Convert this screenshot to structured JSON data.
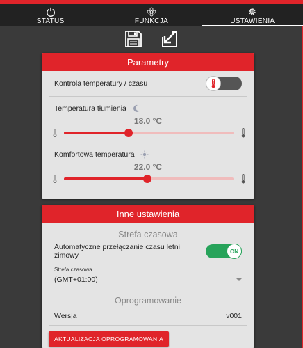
{
  "tabs": [
    {
      "label": "STATUS",
      "icon": "power-icon"
    },
    {
      "label": "FUNKCJA",
      "icon": "flower-icon"
    },
    {
      "label": "USTAWIENIA",
      "icon": "gear-icon",
      "active": true
    }
  ],
  "toolbar": {
    "save_icon": "floppy-disk-icon",
    "load_icon": "import-arrow-icon"
  },
  "parametry": {
    "title": "Parametry",
    "control_label": "Kontrola temperatury / czasu",
    "control_toggle": "off",
    "night": {
      "label": "Temperatura tłumienia",
      "icon": "moon-icon",
      "value": "18.0 °C",
      "level": 0.38
    },
    "comfort": {
      "label": "Komfortowa temperatura",
      "icon": "sun-icon",
      "value": "22.0 °C",
      "level": 0.49
    }
  },
  "inne": {
    "title": "Inne ustawienia",
    "timezone_section": "Strefa czasowa",
    "auto_dst_label": "Automatyczne przełączanie czasu letni zimowy",
    "auto_dst_toggle": "ON",
    "tz_field_label": "Strefa czasowa",
    "tz_value": "(GMT+01:00)",
    "firmware_section": "Oprogramowanie",
    "version_label": "Wersja",
    "version_value": "v001",
    "update_button": "AKTUALIZACJA OPROGRAMOWANIA"
  },
  "colors": {
    "accent": "#e0242a",
    "toggle_on": "#27a35a",
    "card_bg": "#e4e4e4",
    "page_bg": "#3a3a3a"
  }
}
